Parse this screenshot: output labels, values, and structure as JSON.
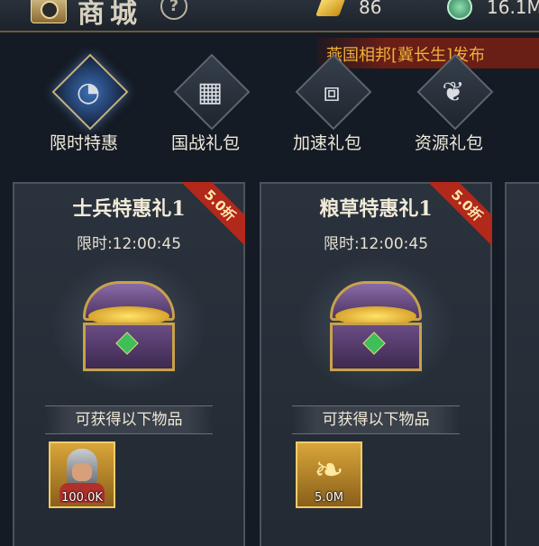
{
  "header": {
    "title": "商城",
    "help_icon": "?",
    "currencies": [
      {
        "icon": "gold-ingot-icon",
        "value": "86"
      },
      {
        "icon": "jade-coin-icon",
        "value": "16.1M"
      }
    ]
  },
  "broadcast": {
    "text": "燕国相邦[冀长生]发布"
  },
  "categories": [
    {
      "label": "限时特惠",
      "icon": "timer-icon",
      "active": true
    },
    {
      "label": "国战礼包",
      "icon": "blocks-icon",
      "active": false
    },
    {
      "label": "加速礼包",
      "icon": "gift-box-icon",
      "active": false
    },
    {
      "label": "资源礼包",
      "icon": "leaf-icon",
      "active": false
    }
  ],
  "cards": [
    {
      "title": "士兵特惠礼1",
      "timer": "限时:12:00:45",
      "discount": "5.0折",
      "rewards_header": "可获得以下物品",
      "reward": {
        "icon": "soldier-icon",
        "qty": "100.0K"
      }
    },
    {
      "title": "粮草特惠礼1",
      "timer": "限时:12:00:45",
      "discount": "5.0折",
      "rewards_header": "可获得以下物品",
      "reward": {
        "icon": "wheat-icon",
        "qty": "5.0M"
      }
    }
  ],
  "colors": {
    "accent_gold": "#c8a24a",
    "discount_ribbon": "#b2281b",
    "broadcast_text": "#f0b03a"
  }
}
